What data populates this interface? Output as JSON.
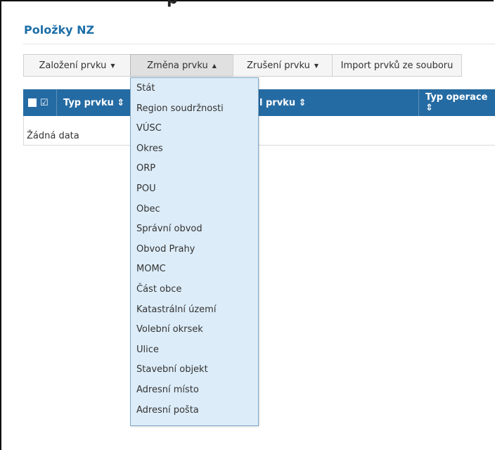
{
  "panel": {
    "title": "Položky NZ"
  },
  "toolbar": {
    "buttons": [
      {
        "label": "Založení prvku",
        "caret": "▼"
      },
      {
        "label": "Změna prvku",
        "caret": "▲"
      },
      {
        "label": "Zrušení prvku",
        "caret": "▼"
      },
      {
        "label": "Import prvků ze souboru"
      }
    ]
  },
  "table": {
    "columns": [
      {
        "label": "Typ prvku ⇕"
      },
      {
        "label": "l prvku ⇕"
      },
      {
        "label": "Typ operace ⇕"
      }
    ],
    "empty_text": "Žádná data"
  },
  "dropdown": {
    "items": [
      "Stát",
      "Region soudržnosti",
      "VÚSC",
      "Okres",
      "ORP",
      "POU",
      "Obec",
      "Správní obvod",
      "Obvod Prahy",
      "MOMC",
      "Část obce",
      "Katastrální území",
      "Volební okrsek",
      "Ulice",
      "Stavební objekt",
      "Adresní místo",
      "Adresní pošta"
    ]
  },
  "icons": {
    "select_all": "checkbox-square-icon",
    "check_all": "check-square-icon"
  },
  "colors": {
    "accent": "#1d6fa8",
    "header_bg": "#256ba3",
    "dropdown_bg": "#dcecf8"
  }
}
